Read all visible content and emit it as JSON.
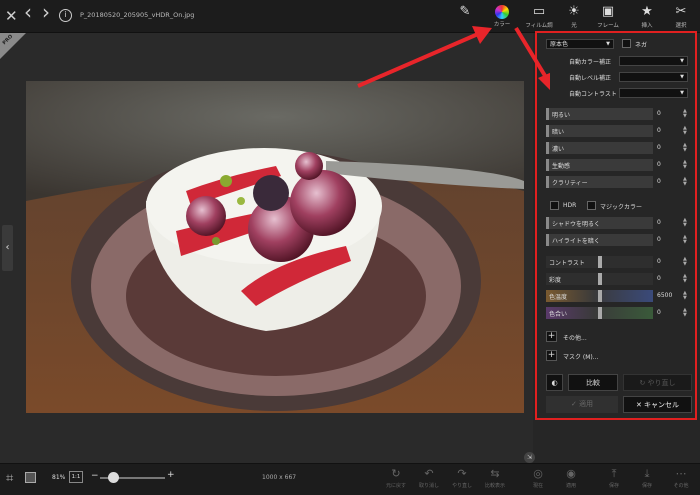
{
  "file": {
    "name": "P_20180520_205905_vHDR_On.jpg"
  },
  "nav": {
    "close": "✕",
    "back": "‹",
    "forward": "›",
    "info": "i"
  },
  "toolbar": [
    {
      "id": "edit",
      "glyph": "✎",
      "label": ""
    },
    {
      "id": "color",
      "glyph": "◉",
      "label": "カラー"
    },
    {
      "id": "film",
      "glyph": "▭",
      "label": "フィルム調"
    },
    {
      "id": "light",
      "glyph": "☀",
      "label": "光"
    },
    {
      "id": "frame",
      "glyph": "▣",
      "label": "フレーム"
    },
    {
      "id": "insert",
      "glyph": "★",
      "label": "挿入"
    },
    {
      "id": "select",
      "glyph": "✂",
      "label": "選択"
    }
  ],
  "badge": "PRO",
  "panel": {
    "preset": "原本色",
    "nega": "ネガ",
    "auto_color": "自動カラー補正",
    "auto_level": "自動レベル補正",
    "auto_contrast": "自動コントラスト",
    "sliders1": [
      {
        "label": "明るい",
        "value": "0"
      },
      {
        "label": "暗い",
        "value": "0"
      },
      {
        "label": "濃い",
        "value": "0"
      },
      {
        "label": "生動感",
        "value": "0"
      },
      {
        "label": "クラリティー",
        "value": "0"
      }
    ],
    "hdr": "HDR",
    "magic": "マジックカラー",
    "sliders2": [
      {
        "label": "シャドウを明るく",
        "value": "0"
      },
      {
        "label": "ハイライトを暗く",
        "value": "0"
      }
    ],
    "sliders3": [
      {
        "label": "コントラスト",
        "value": "0"
      },
      {
        "label": "彩度",
        "value": "0"
      },
      {
        "label": "色温度",
        "value": "6500"
      },
      {
        "label": "色合い",
        "value": "0"
      }
    ],
    "other": "その他...",
    "mask": "マスク (M)...",
    "compare": "比較",
    "redo": "やり直し",
    "apply": "適用",
    "cancel": "キャンセル"
  },
  "status": {
    "zoom": "81%",
    "ratio": "1:1",
    "size": "1000 x 667"
  },
  "bottom": [
    {
      "glyph": "↻",
      "label": "元に戻す"
    },
    {
      "glyph": "↶",
      "label": "取り消し"
    },
    {
      "glyph": "↷",
      "label": "やり直し"
    },
    {
      "glyph": "⇆",
      "label": "比較表示"
    },
    {
      "glyph": "◎",
      "label": "現在"
    },
    {
      "glyph": "◉",
      "label": "適用"
    },
    {
      "glyph": "⤒",
      "label": "保存"
    },
    {
      "glyph": "⤓",
      "label": "保存"
    },
    {
      "glyph": "⋯",
      "label": "その他"
    }
  ],
  "colors": {
    "accent": "#e02020",
    "panel": "#262626",
    "slider": "#3a3a3a",
    "temp": "#4a5a8a",
    "tint": "#4a3a5a"
  }
}
